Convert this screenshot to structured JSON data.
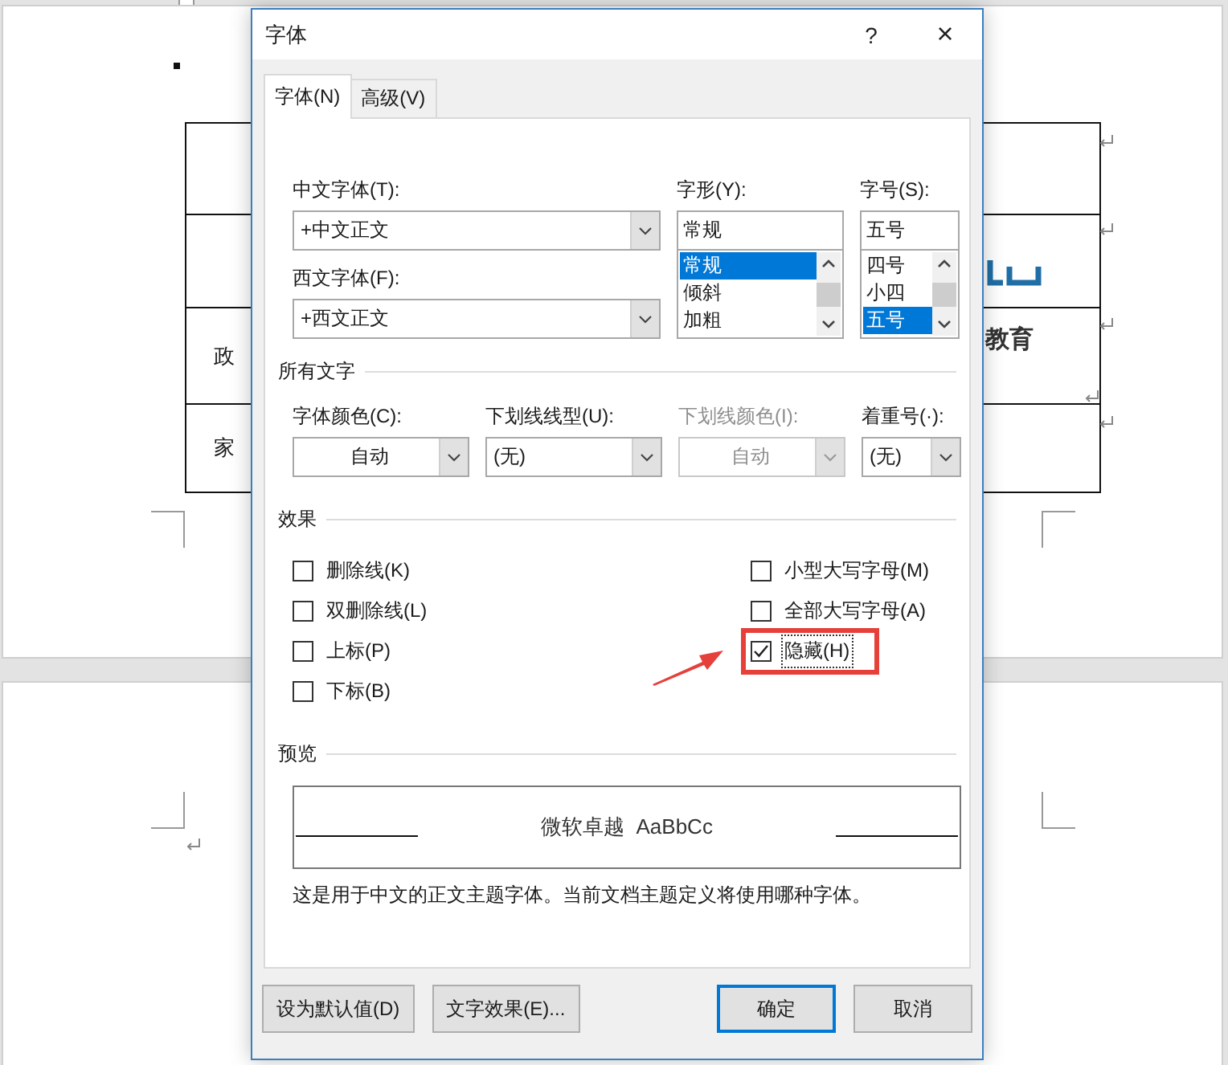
{
  "document": {
    "table": {
      "rows": [
        {
          "kind": "blank"
        },
        {
          "kind": "blank"
        },
        {
          "kind": "text",
          "label": "政"
        },
        {
          "kind": "text",
          "label": "家"
        }
      ]
    },
    "logo_text": "教育"
  },
  "window": {
    "title": "字体",
    "help": "?",
    "close": "×"
  },
  "tabs": [
    {
      "label": "字体(N)",
      "selected": true
    },
    {
      "label": "高级(V)",
      "selected": false
    }
  ],
  "font": {
    "chinese_label": "中文字体(T):",
    "chinese_value": "+中文正文",
    "western_label": "西文字体(F):",
    "western_value": "+西文正文",
    "style_label": "字形(Y):",
    "style_value": "常规",
    "style_items": [
      {
        "label": "常规",
        "selected": true
      },
      {
        "label": "倾斜",
        "selected": false
      },
      {
        "label": "加粗",
        "selected": false
      }
    ],
    "size_label": "字号(S):",
    "size_value": "五号",
    "size_items": [
      {
        "label": "四号",
        "selected": false
      },
      {
        "label": "小四",
        "selected": false
      },
      {
        "label": "五号",
        "selected": true
      }
    ]
  },
  "all_text": {
    "title": "所有文字",
    "dropdowns": [
      {
        "label": "字体颜色(C):",
        "value": "自动",
        "kind": "color",
        "disabled": false
      },
      {
        "label": "下划线线型(U):",
        "value": "(无)",
        "kind": "list",
        "disabled": false
      },
      {
        "label": "下划线颜色(I):",
        "value": "自动",
        "kind": "color",
        "disabled": true
      },
      {
        "label": "着重号(·):",
        "value": "(无)",
        "kind": "list",
        "disabled": false
      }
    ]
  },
  "effects": {
    "title": "效果",
    "column_1": [
      {
        "label": "删除线(K)",
        "checked": false,
        "focused": false
      },
      {
        "label": "双删除线(L)",
        "checked": false,
        "focused": false
      },
      {
        "label": "上标(P)",
        "checked": false,
        "focused": false
      },
      {
        "label": "下标(B)",
        "checked": false,
        "focused": false
      }
    ],
    "column_2": [
      {
        "label": "小型大写字母(M)",
        "checked": false,
        "focused": false
      },
      {
        "label": "全部大写字母(A)",
        "checked": false,
        "focused": false
      },
      {
        "label": "隐藏(H)",
        "checked": true,
        "focused": true,
        "highlighted": true
      }
    ]
  },
  "preview": {
    "title": "预览",
    "sample": "微软卓越  AaBbCc",
    "description": "这是用于中文的正文主题字体。当前文档主题定义将使用哪种字体。"
  },
  "buttons": [
    {
      "label": "设为默认值(D)",
      "default": false
    },
    {
      "label": "文字效果(E)...",
      "default": false
    },
    {
      "label": "确定",
      "default": true
    },
    {
      "label": "取消",
      "default": false
    }
  ]
}
